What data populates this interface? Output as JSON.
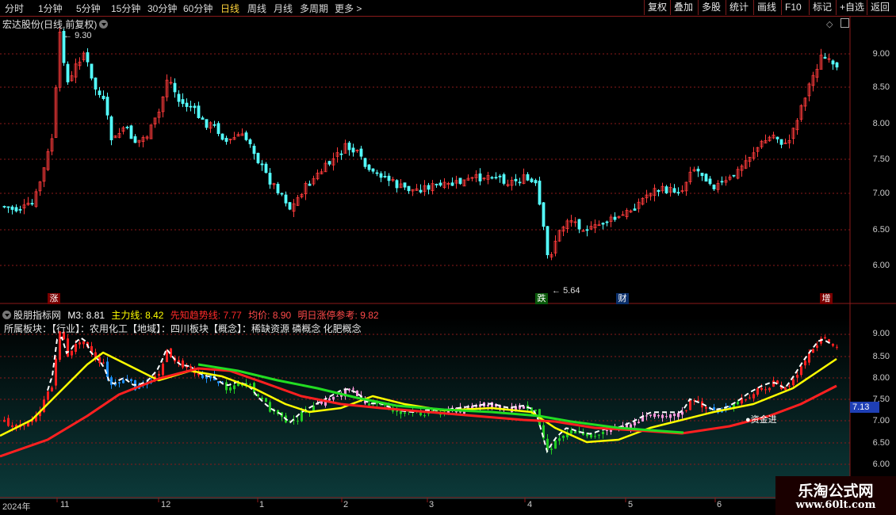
{
  "toolbar": {
    "periods": [
      "分时",
      "1分钟",
      "5分钟",
      "15分钟",
      "30分钟",
      "60分钟",
      "日线",
      "周线",
      "月线",
      "多周期",
      "更多 >"
    ],
    "active_period": "日线",
    "right_buttons": [
      "复权",
      "叠加",
      "多股",
      "统计",
      "画线",
      "F10",
      "标记",
      "+自选",
      "返回"
    ]
  },
  "main_panel": {
    "title": "宏达股份(日线,前复权)",
    "high_label": "9.30",
    "low_label": "5.64",
    "price_axis": [
      "9.00",
      "8.50",
      "8.00",
      "7.50",
      "7.00",
      "6.50",
      "6.00"
    ],
    "events": [
      {
        "label": "涨",
        "color": "#e03131"
      },
      {
        "label": "跌",
        "color": "#2f9e44"
      },
      {
        "label": "财",
        "color": "#1c7ed6"
      },
      {
        "label": "增",
        "color": "#e03131"
      }
    ]
  },
  "indicator_panel": {
    "name": "股朋指标网",
    "items": [
      {
        "label": "M3: 8.81",
        "color": "#ffffff"
      },
      {
        "label": "主力线: 8.42",
        "color": "#ffff00"
      },
      {
        "label": "先知趋势线: 7.77",
        "color": "#ff2222"
      },
      {
        "label": "均价: 8.90",
        "color": "#ff4444"
      },
      {
        "label": "明日涨停参考: 9.82",
        "color": "#ff4444"
      }
    ],
    "sector_text": "所属板块：【行业】：农用化工【地域】：四川板块【概念】：稀缺资源 磷概念 化肥概念",
    "annotation": "资金进",
    "price_tag": "7.13",
    "price_axis": [
      "9.00",
      "8.50",
      "8.00",
      "7.50",
      "7.00",
      "6.50",
      "6.00"
    ]
  },
  "date_axis": [
    "2024年",
    "11",
    "12",
    "1",
    "2",
    "3",
    "4",
    "5",
    "6"
  ],
  "watermark": {
    "line1": "乐淘公式网",
    "line2": "www.60lt.com"
  },
  "colors": {
    "up": "#ff3b3b",
    "down": "#54ffff",
    "grid_red": "#8b1a1a",
    "white_line": "#ffffff",
    "yellow_line": "#ffff00",
    "red_line": "#ff2020",
    "green_line": "#22dd22"
  }
}
